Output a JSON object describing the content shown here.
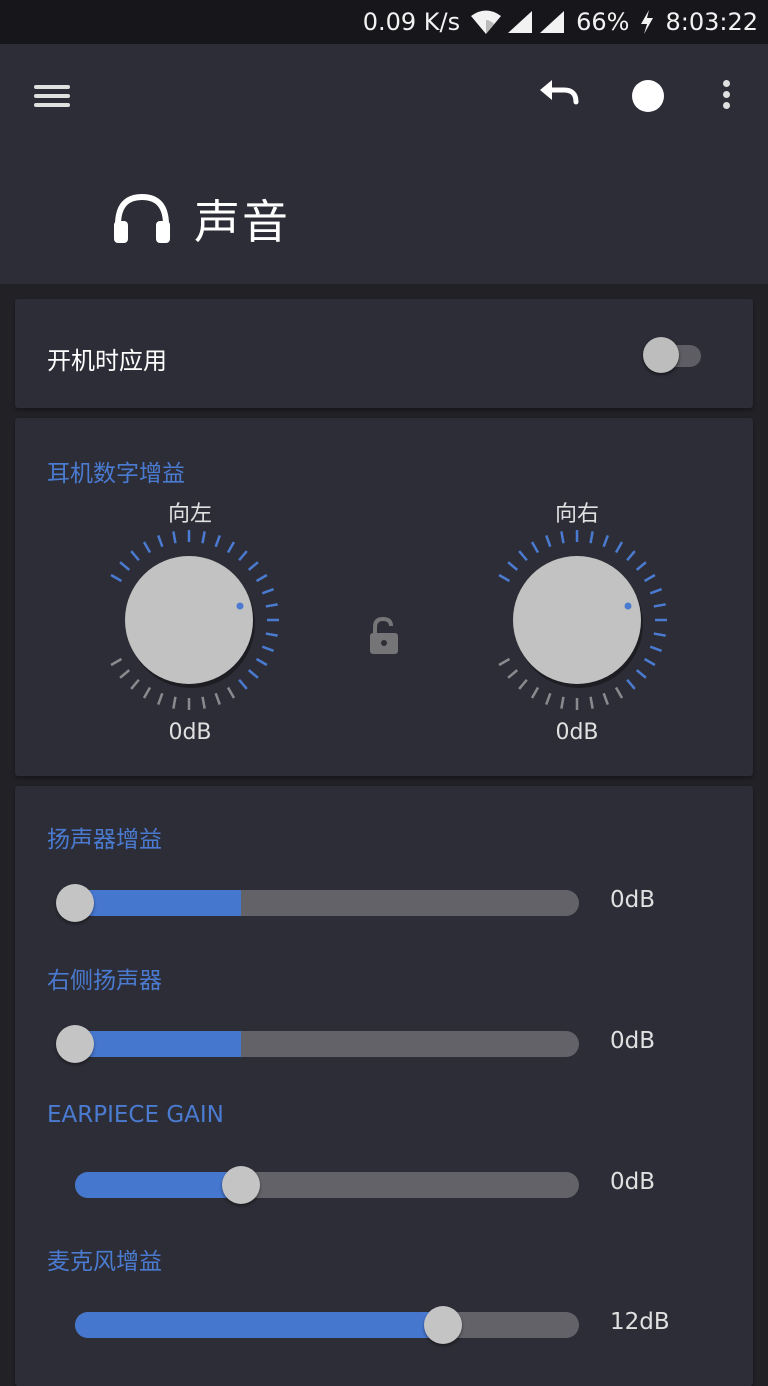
{
  "status_bar": {
    "speed": "0.09 K/s",
    "battery": "66%",
    "time": "8:03:22",
    "icons": [
      "wifi-icon",
      "signal-icon",
      "signal-icon",
      "charging-icon"
    ]
  },
  "app_bar": {
    "title": "声音",
    "title_icon": "headphones-icon",
    "actions": [
      "menu-icon",
      "undo-icon",
      "record-icon",
      "more-vert-icon"
    ]
  },
  "boot_apply": {
    "label": "开机时应用",
    "enabled": false
  },
  "headphone_gain": {
    "title": "耳机数字增益",
    "left": {
      "label": "向左",
      "value": "0dB"
    },
    "right": {
      "label": "向右",
      "value": "0dB"
    },
    "lock_icon": "unlocked-icon"
  },
  "gains": {
    "speaker": {
      "title": "扬声器增益",
      "value": "0dB",
      "fill_fraction": 0.33,
      "thumb_fraction": 0.0
    },
    "right_speaker": {
      "title": "右侧扬声器",
      "value": "0dB",
      "fill_fraction": 0.33,
      "thumb_fraction": 0.0
    },
    "earpiece": {
      "title": "EARPIECE GAIN",
      "value": "0dB",
      "fill_fraction": 0.33,
      "thumb_fraction": 0.33
    },
    "microphone": {
      "title": "麦克风增益",
      "value": "12dB",
      "fill_fraction": 0.73,
      "thumb_fraction": 0.73
    }
  },
  "colors": {
    "accent": "#4a7bd0",
    "background": "#212126",
    "card": "#2d2d37"
  }
}
